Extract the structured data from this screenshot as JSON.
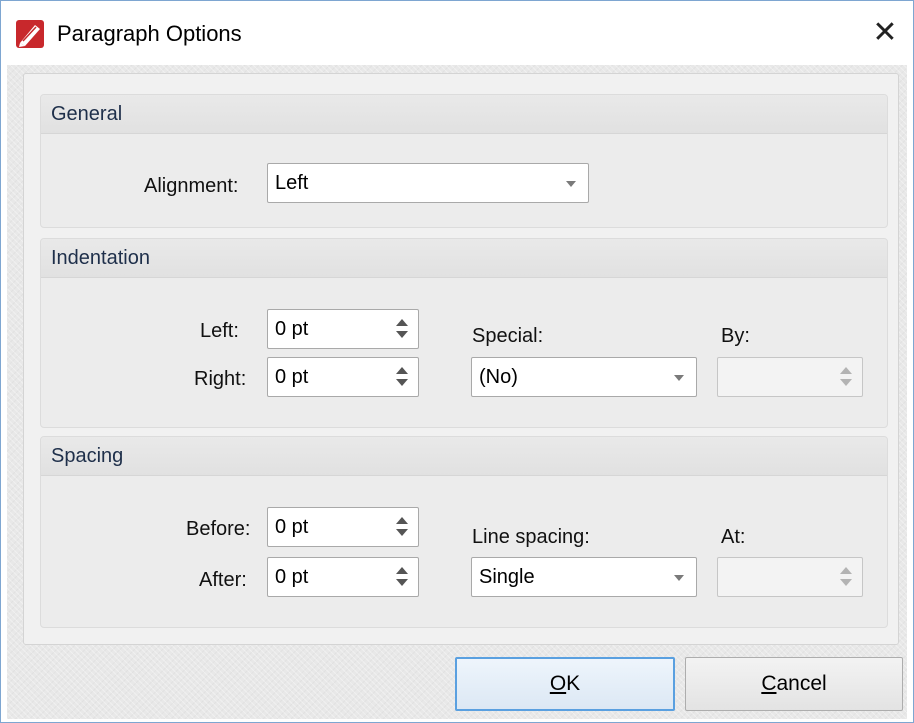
{
  "window": {
    "title": "Paragraph Options",
    "close_glyph": "✕"
  },
  "general": {
    "header": "General",
    "alignment_label": "Alignment:",
    "alignment_value": "Left"
  },
  "indentation": {
    "header": "Indentation",
    "left_label": "Left:",
    "left_value": "0 pt",
    "right_label": "Right:",
    "right_value": "0 pt",
    "special_label": "Special:",
    "special_value": "(No)",
    "by_label": "By:",
    "by_value": ""
  },
  "spacing": {
    "header": "Spacing",
    "before_label": "Before:",
    "before_value": "0 pt",
    "after_label": "After:",
    "after_value": "0 pt",
    "line_spacing_label": "Line spacing:",
    "line_spacing_value": "Single",
    "at_label": "At:",
    "at_value": ""
  },
  "buttons": {
    "ok_accel": "O",
    "ok_rest": "K",
    "cancel_accel": "C",
    "cancel_rest": "ancel"
  },
  "colors": {
    "accent": "#5aa0e0",
    "icon_red": "#c8282c"
  },
  "icons": {
    "app": "pdf-editor-pen-icon",
    "close": "close-icon",
    "dropdown": "chevron-down-icon",
    "spinner": "spin-arrows-icon"
  }
}
